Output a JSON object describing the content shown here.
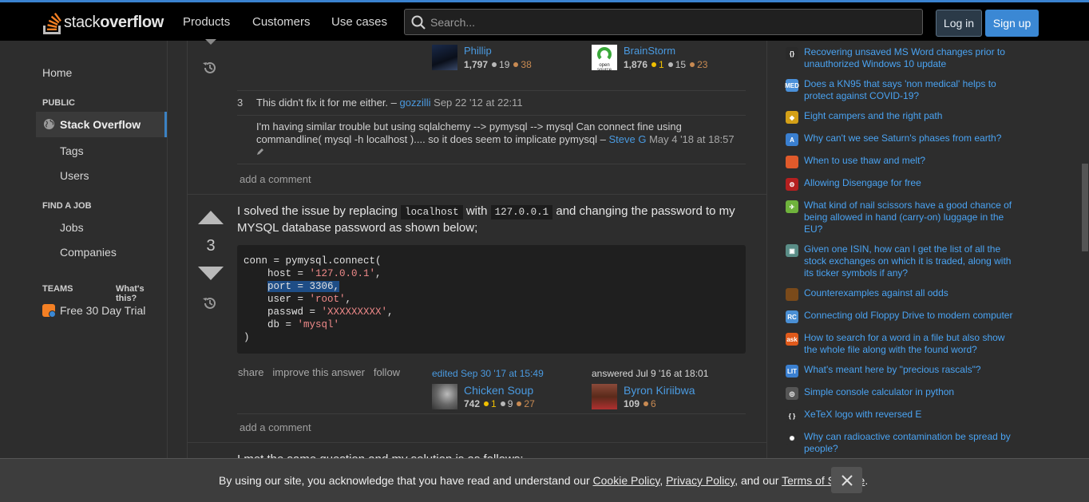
{
  "header": {
    "logo_light": "stack",
    "logo_bold": "overflow",
    "nav": [
      "Products",
      "Customers",
      "Use cases"
    ],
    "search_placeholder": "Search...",
    "login": "Log in",
    "signup": "Sign up"
  },
  "leftnav": {
    "home": "Home",
    "public": "PUBLIC",
    "stackoverflow": "Stack Overflow",
    "tags": "Tags",
    "users": "Users",
    "findjob": "FIND A JOB",
    "jobs": "Jobs",
    "companies": "Companies",
    "teams": "TEAMS",
    "whats_this": "What's this?",
    "trial": "Free 30 Day Trial"
  },
  "top_users": [
    {
      "name": "Phillip",
      "rep": "1,797",
      "silver": "19",
      "bronze": "38"
    },
    {
      "name": "BrainStorm",
      "rep": "1,876",
      "gold": "1",
      "silver": "15",
      "bronze": "23",
      "avatar_text": "open source"
    }
  ],
  "comments1": [
    {
      "score": "3",
      "text": "This didn't fix it for me either. –",
      "user": "gozzilli",
      "date": "Sep 22 '12 at 22:11"
    },
    {
      "score": "",
      "text_line1": "I'm having similar trouble but using sqlalchemy --> pymysql --> mysql Can connect fine using",
      "text_line2": "commandline( mysql -h localhost ).... so it does seem to implicate pymysql –",
      "user": "Steve G",
      "date": "May 4 '18 at 18:57"
    }
  ],
  "add_comment": "add a comment",
  "answer": {
    "score": "3",
    "p1_a": "I solved the issue by replacing",
    "code1": "localhost",
    "p1_b": "with",
    "code2": "127.0.0.1",
    "p1_c": "and changing the password to my",
    "p2": "MYSQL database password as shown below;",
    "code": {
      "l1": "conn = pymysql.connect(",
      "host_key": "    host = ",
      "host_val": "'127.0.0.1'",
      "port": "port = 3306,",
      "user_key": "    user = ",
      "user_val": "'root'",
      "passwd_key": "    passwd = ",
      "passwd_val": "'XXXXXXXXX'",
      "db_key": "    db = ",
      "db_val": "'mysql'",
      "close": ")"
    },
    "actions": {
      "share": "share",
      "improve": "improve this answer",
      "follow": "follow"
    },
    "edited": "edited Sep 30 '17 at 15:49",
    "editor": {
      "name": "Chicken Soup",
      "rep": "742",
      "gold": "1",
      "silver": "9",
      "bronze": "27"
    },
    "answered": "answered Jul 9 '16 at 18:01",
    "author": {
      "name": "Byron Kiriibwa",
      "rep": "109",
      "bronze": "6"
    }
  },
  "next_answer_partial": "I met the same question and my solution is as follows:",
  "hot_questions": [
    {
      "text": "Recovering unsaved MS Word changes prior to unauthorized Windows 10 update",
      "icon": "{}",
      "color": "#2a2a2a"
    },
    {
      "text": "Does a KN95 that says 'non medical' helps to protect against COVID-19?",
      "icon": "MED",
      "color": "#4a90d9"
    },
    {
      "text": "Eight campers and the right path",
      "icon": "◆",
      "color": "#d4a017"
    },
    {
      "text": "Why can't we see Saturn's phases from earth?",
      "icon": "A",
      "color": "#3a7fd0"
    },
    {
      "text": "When to use thaw and melt?",
      "icon": "",
      "color": "#e05a2b"
    },
    {
      "text": "Allowing Disengage for free",
      "icon": "⚙",
      "color": "#b52020"
    },
    {
      "text": "What kind of nail scissors have a good chance of being allowed in hand (carry-on) luggage in the EU?",
      "icon": "✈",
      "color": "#6fb33c"
    },
    {
      "text": "Given one ISIN, how can I get the list of all the stock exchanges on which it is traded, along with its ticker symbols if any?",
      "icon": "▣",
      "color": "#5a8d87"
    },
    {
      "text": "Counterexamples against all odds",
      "icon": "",
      "color": "#7a4a1a"
    },
    {
      "text": "Connecting old Floppy Drive to modern computer",
      "icon": "RC",
      "color": "#4a8fd4"
    },
    {
      "text": "How to search for a word in a file but also show the whole file along with the found word?",
      "icon": "ask",
      "color": "#e05a1b"
    },
    {
      "text": "What's meant here by \"precious rascals\"?",
      "icon": "LIT",
      "color": "#3a7fd0"
    },
    {
      "text": "Simple console calculator in python",
      "icon": "◎",
      "color": "#555"
    },
    {
      "text": "XeTeX logo with reversed E",
      "icon": "{ }",
      "color": "#2d2d2d"
    },
    {
      "text": "Why can radioactive contamination be spread by people?",
      "icon": "✺",
      "color": "#2d2d2d"
    }
  ],
  "cookie": {
    "text_a": "By using our site, you acknowledge that you have read and understand our",
    "cookie_policy": "Cookie Policy",
    "comma": ",",
    "privacy_policy": "Privacy Policy",
    "and_our": ", and our",
    "terms": "Terms of Service",
    "period": "."
  },
  "colors": {
    "accent": "#3b88d4",
    "link": "#4aa3f2",
    "bg": "#2d2d2d"
  }
}
